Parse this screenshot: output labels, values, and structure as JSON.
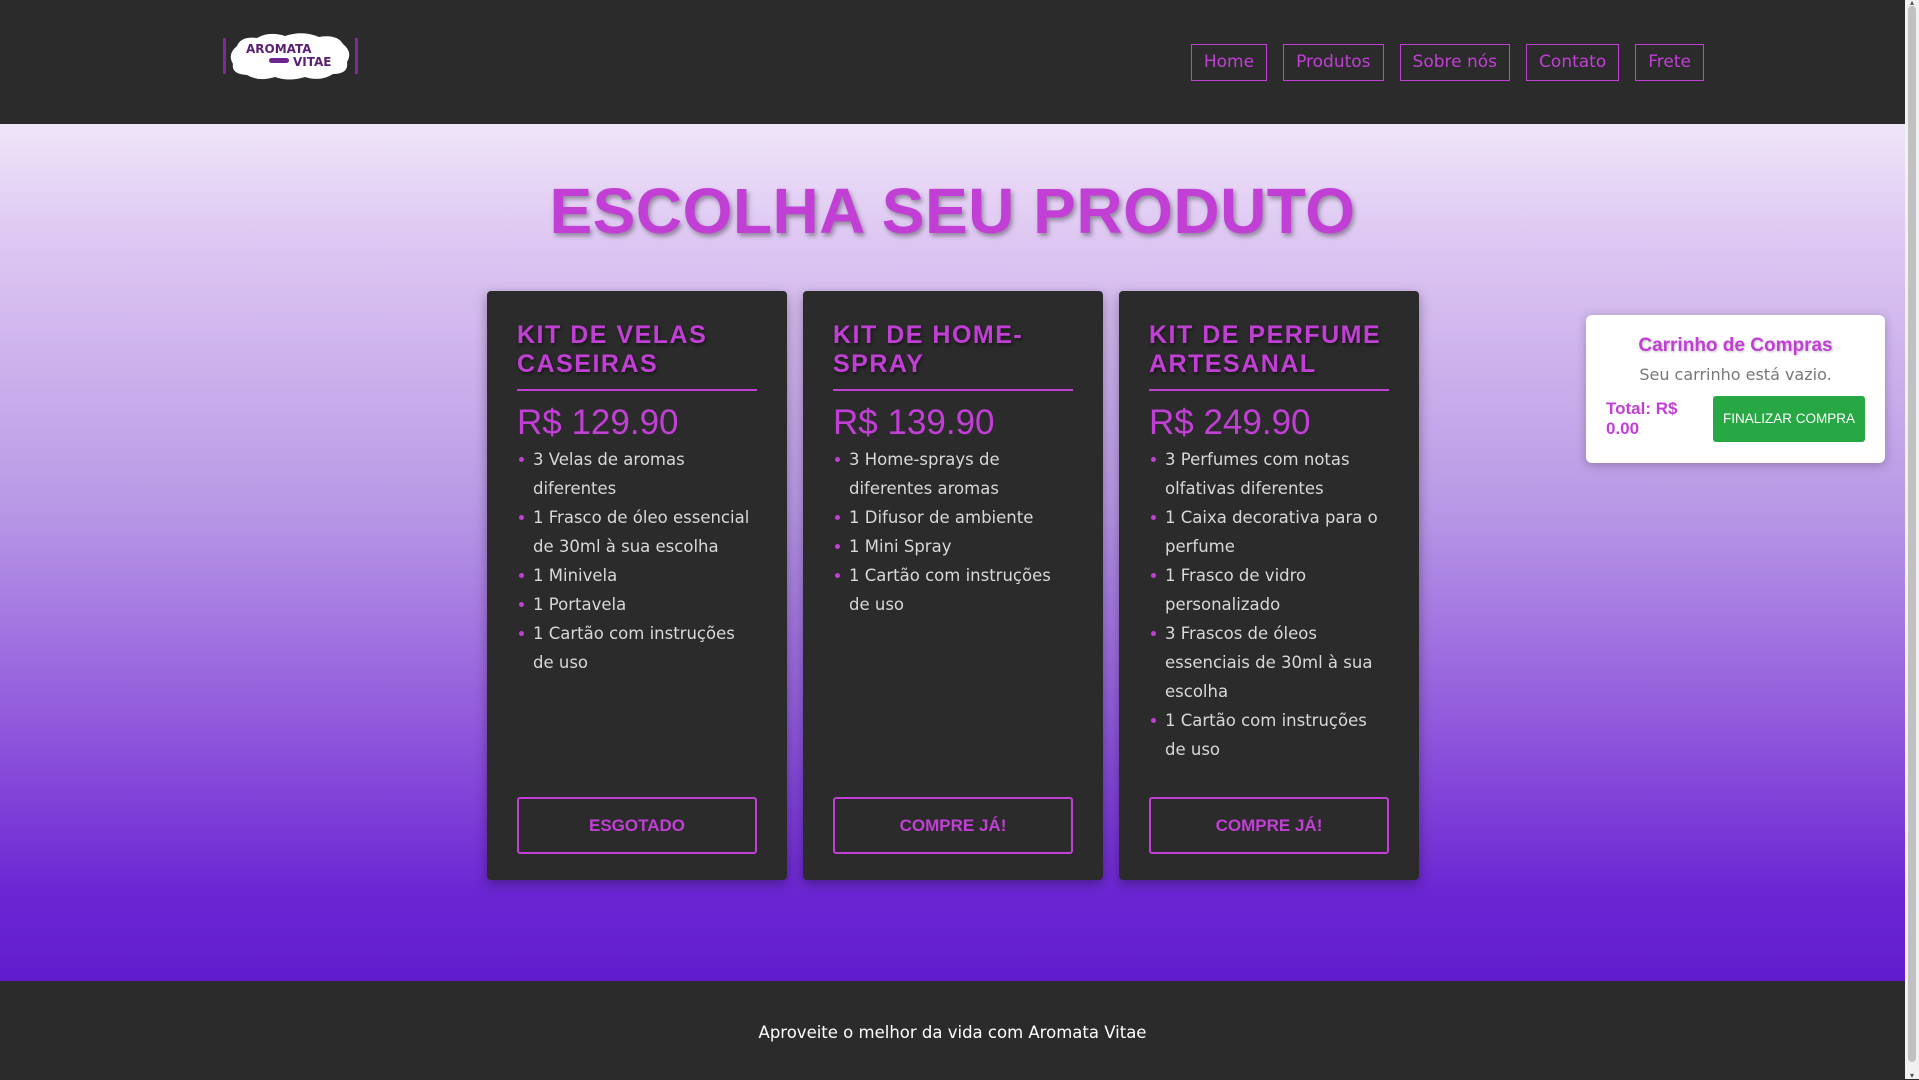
{
  "header": {
    "logo": {
      "line1": "AROMATA",
      "line2": "VITAE"
    },
    "nav": [
      {
        "label": "Home"
      },
      {
        "label": "Produtos"
      },
      {
        "label": "Sobre nós"
      },
      {
        "label": "Contato"
      },
      {
        "label": "Frete"
      }
    ]
  },
  "main": {
    "title": "ESCOLHA SEU PRODUTO",
    "products": [
      {
        "title": "KIT DE VELAS CASEIRAS",
        "price": "R$ 129.90",
        "items": [
          "3 Velas de aromas diferentes",
          "1 Frasco de óleo essencial de 30ml à sua escolha",
          "1 Minivela",
          "1 Portavela",
          "1 Cartão com instruções de uso"
        ],
        "button": "ESGOTADO"
      },
      {
        "title": "KIT DE HOME-SPRAY",
        "price": "R$ 139.90",
        "items": [
          "3 Home-sprays de diferentes aromas",
          "1 Difusor de ambiente",
          "1 Mini Spray",
          "1 Cartão com instruções de uso"
        ],
        "button": "COMPRE JÁ!"
      },
      {
        "title": "KIT DE PERFUME ARTESANAL",
        "price": "R$ 249.90",
        "items": [
          "3 Perfumes com notas olfativas diferentes",
          "1 Caixa decorativa para o perfume",
          "1 Frasco de vidro personalizado",
          "3 Frascos de óleos essenciais de 30ml à sua escolha",
          "1 Cartão com instruções de uso"
        ],
        "button": "COMPRE JÁ!"
      }
    ]
  },
  "cart": {
    "title": "Carrinho de Compras",
    "empty_message": "Seu carrinho está vazio.",
    "total": "Total: R$ 0.00",
    "checkout_label": "Finalizar Compra"
  },
  "footer": {
    "text": "Aproveite o melhor da vida com Aromata Vitae"
  },
  "colors": {
    "accent": "#c23fd6",
    "dark": "#2b2b2b",
    "checkout": "#28a745"
  }
}
